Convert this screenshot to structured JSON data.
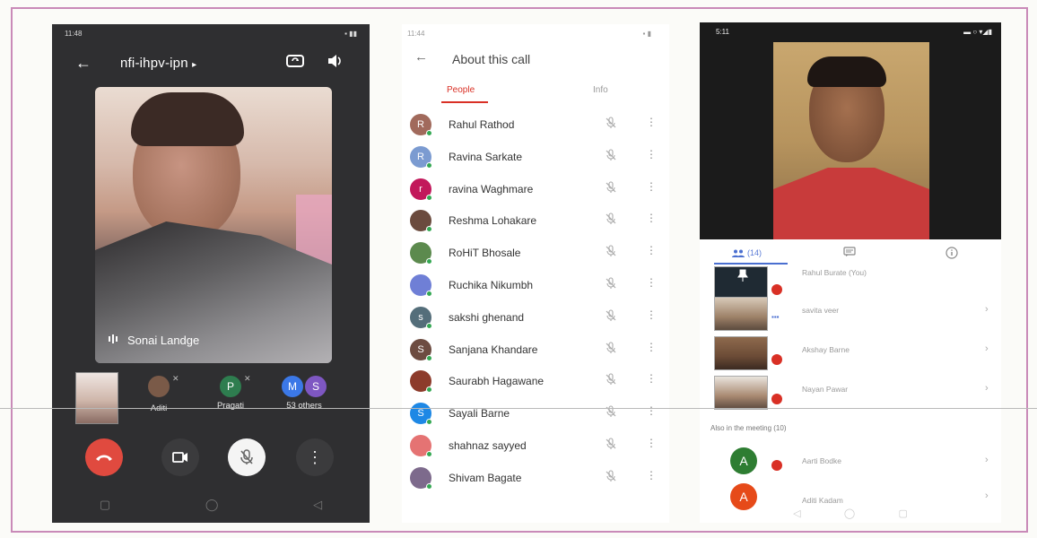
{
  "phone1": {
    "status_time": "11:48",
    "status_icons": "ೢ ೢ…",
    "meeting_code": "nfi-ihpv-ipn",
    "meeting_code_chevron": "▸",
    "main_speaker_name": "Sonai Landge",
    "participants": [
      {
        "name": "Aditi",
        "initial": "",
        "color": "#7a5a48"
      },
      {
        "name": "Pragati",
        "initial": "P",
        "color": "#2e7d4f"
      }
    ],
    "others": {
      "initials": [
        "M",
        "S"
      ],
      "colors": [
        "#3b78e7",
        "#7e57c2"
      ],
      "label": "53 others"
    }
  },
  "phone2": {
    "status_time": "11:44",
    "title": "About this call",
    "tabs": [
      "People",
      "Info"
    ],
    "people": [
      {
        "name": "Rahul Rathod",
        "initial": "R",
        "color": "#a16a5c"
      },
      {
        "name": "Ravina Sarkate",
        "initial": "R",
        "color": "#7b9bd1"
      },
      {
        "name": "ravina Waghmare",
        "initial": "r",
        "color": "#c2185b"
      },
      {
        "name": "Reshma Lohakare",
        "initial": "",
        "color": "#6b4b3e"
      },
      {
        "name": "RoHiT Bhosale",
        "initial": "",
        "color": "#5c8a4e"
      },
      {
        "name": "Ruchika Nikumbh",
        "initial": "",
        "color": "#6f7fd6"
      },
      {
        "name": "sakshi ghenand",
        "initial": "s",
        "color": "#546e7a"
      },
      {
        "name": "Sanjana Khandare",
        "initial": "S",
        "color": "#6d4c41"
      },
      {
        "name": "Saurabh Hagawane",
        "initial": "",
        "color": "#8d3b2b"
      },
      {
        "name": "Sayali Barne",
        "initial": "S",
        "color": "#1e88e5"
      },
      {
        "name": "shahnaz sayyed",
        "initial": "",
        "color": "#e57373"
      },
      {
        "name": "Shivam Bagate",
        "initial": "",
        "color": "#7d6a8c"
      }
    ]
  },
  "phone3": {
    "status_time": "5:11",
    "people_tab_count": "(14)",
    "speakers": [
      {
        "name": "Rahul Burate (You)"
      },
      {
        "name": "savita veer"
      },
      {
        "name": "Akshay Barne"
      },
      {
        "name": "Nayan Pawar"
      }
    ],
    "also_label": "Also in the meeting (10)",
    "also": [
      {
        "name": "Aarti Bodke",
        "initial": "A",
        "color": "#2e7d32"
      },
      {
        "name": "Aditi Kadam",
        "initial": "A",
        "color": "#e64a19"
      }
    ]
  },
  "colors": {
    "end_call": "#e04a3f",
    "accent_red": "#d93025",
    "meet_blue": "#4a6fd0",
    "online_green": "#34a853"
  }
}
